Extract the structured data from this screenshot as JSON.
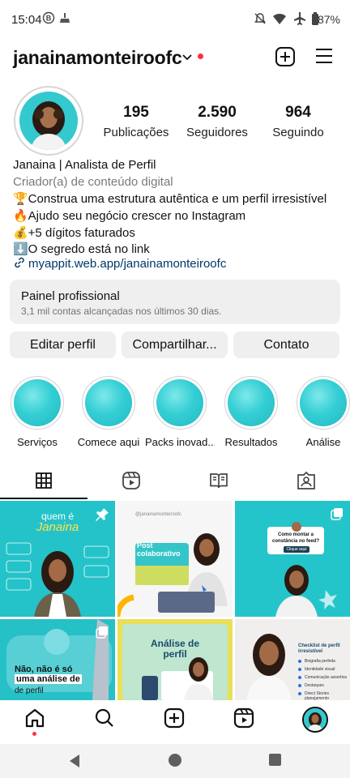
{
  "status_bar": {
    "time": "15:04",
    "battery": "87%"
  },
  "profile": {
    "username": "janainamonteiroofc",
    "stats": [
      {
        "value": "195",
        "label": "Publicações"
      },
      {
        "value": "2.590",
        "label": "Seguidores"
      },
      {
        "value": "964",
        "label": "Seguindo"
      }
    ],
    "name_line": "Janaina | Analista de Perfil",
    "category": "Criador(a) de conteúdo digital",
    "bio_lines": [
      "🏆Construa uma estrutura autêntica e um perfil irresistível",
      "🔥Ajudo seu negócio crescer no Instagram",
      "💰+5 dígitos faturados",
      "⬇️O segredo está no link"
    ],
    "link": "myappit.web.app/janainamonteiroofc"
  },
  "dashboard": {
    "title": "Painel profissional",
    "subtitle": "3,1 mil contas alcançadas nos últimos 30 dias."
  },
  "actions": {
    "edit": "Editar perfil",
    "share": "Compartilhar...",
    "contact": "Contato"
  },
  "highlights": [
    "Serviços",
    "Comece aqui",
    "Packs inovad...",
    "Resultados",
    "Análise"
  ],
  "posts": [
    {
      "title": "quem é",
      "subtitle": "Janaina"
    },
    {
      "title": "Post colaborativo",
      "handle": "@janainamonteiroofc"
    },
    {
      "title": "Como montar a constância no feed?",
      "cta": "Clique aqui"
    },
    {
      "title": "Não, não é só",
      "highlight": "uma análise de",
      "tail": "de perfil"
    },
    {
      "title": "Análise de perfil"
    },
    {
      "title": "Checklist de perfil irresistível",
      "items": [
        "Biografia perfeita",
        "Identidade visual",
        "Comunicação assertiva",
        "Destaques",
        "Direct Stories planejamento"
      ]
    }
  ],
  "colors": {
    "accent_teal": "#25c3c9",
    "link": "#00376b",
    "notification": "#ff3040"
  }
}
